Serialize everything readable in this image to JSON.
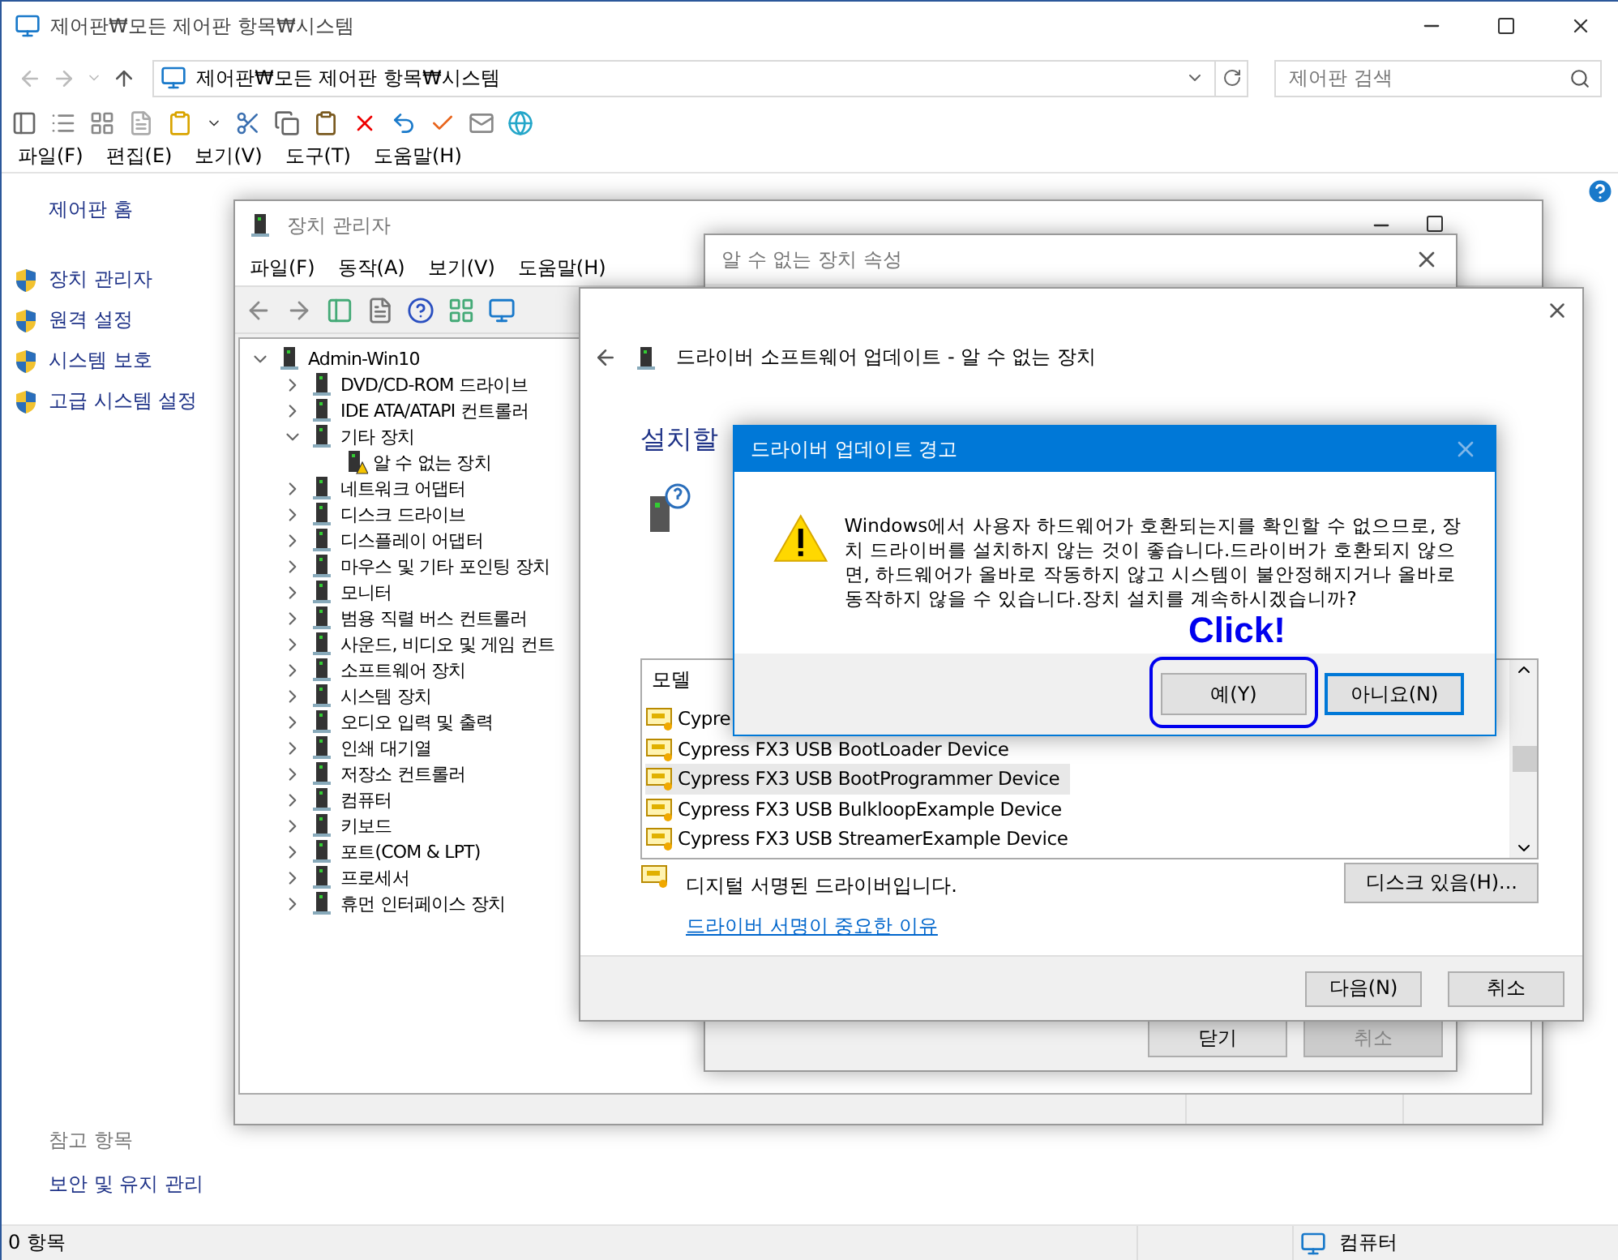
{
  "window": {
    "title": "제어판₩모든 제어판 항목₩시스템"
  },
  "address_bar": {
    "path": "제어판₩모든 제어판 항목₩시스템"
  },
  "search": {
    "placeholder": "제어판 검색"
  },
  "menu": [
    "파일(F)",
    "편집(E)",
    "보기(V)",
    "도구(T)",
    "도움말(H)"
  ],
  "sidebar": {
    "home": "제어판 홈",
    "tasks": [
      "장치 관리자",
      "원격 설정",
      "시스템 보호",
      "고급 시스템 설정"
    ],
    "see_also_title": "참고 항목",
    "see_also": [
      "보안 및 유지 관리"
    ]
  },
  "status_bar": {
    "items": "0 항목",
    "location": "컴퓨터"
  },
  "device_manager": {
    "title": "장치 관리자",
    "menu": [
      "파일(F)",
      "동작(A)",
      "보기(V)",
      "도움말(H)"
    ],
    "tree": {
      "label": "Admin-Win10",
      "expanded": true,
      "children": [
        {
          "label": "DVD/CD-ROM 드라이브",
          "expanded": false
        },
        {
          "label": "IDE ATA/ATAPI 컨트롤러",
          "expanded": false
        },
        {
          "label": "기타 장치",
          "expanded": true,
          "children": [
            {
              "label": "알 수 없는 장치",
              "warning": true
            }
          ]
        },
        {
          "label": "네트워크 어댑터",
          "expanded": false
        },
        {
          "label": "디스크 드라이브",
          "expanded": false
        },
        {
          "label": "디스플레이 어댑터",
          "expanded": false
        },
        {
          "label": "마우스 및 기타 포인팅 장치",
          "expanded": false
        },
        {
          "label": "모니터",
          "expanded": false
        },
        {
          "label": "범용 직렬 버스 컨트롤러",
          "expanded": false
        },
        {
          "label": "사운드, 비디오 및 게임 컨트",
          "expanded": false
        },
        {
          "label": "소프트웨어 장치",
          "expanded": false
        },
        {
          "label": "시스템 장치",
          "expanded": false
        },
        {
          "label": "오디오 입력 및 출력",
          "expanded": false
        },
        {
          "label": "인쇄 대기열",
          "expanded": false
        },
        {
          "label": "저장소 컨트롤러",
          "expanded": false
        },
        {
          "label": "컴퓨터",
          "expanded": false
        },
        {
          "label": "키보드",
          "expanded": false
        },
        {
          "label": "포트(COM & LPT)",
          "expanded": false
        },
        {
          "label": "프로세서",
          "expanded": false
        },
        {
          "label": "휴먼 인터페이스 장치",
          "expanded": false
        }
      ]
    }
  },
  "properties_dialog": {
    "title": "알 수 없는 장치 속성",
    "buttons": [
      {
        "label": "닫기",
        "disabled": false
      },
      {
        "label": "취소",
        "disabled": true
      }
    ]
  },
  "wizard": {
    "title": "드라이버 소프트웨어 업데이트 - 알 수 없는 장치",
    "heading": "설치할",
    "list_header": "모델",
    "models": [
      {
        "name": "Cypre",
        "selected": false
      },
      {
        "name": "Cypress FX3 USB BootLoader Device",
        "selected": false
      },
      {
        "name": "Cypress FX3 USB BootProgrammer Device",
        "selected": true
      },
      {
        "name": "Cypress FX3 USB BulkloopExample Device",
        "selected": false
      },
      {
        "name": "Cypress FX3 USB StreamerExample Device",
        "selected": false
      }
    ],
    "signed_note": "디지털 서명된 드라이버입니다.",
    "link": "드라이버 서명이 중요한 이유",
    "disk_button": "디스크 있음(H)...",
    "buttons": [
      "다음(N)",
      "취소"
    ]
  },
  "alert": {
    "title": "드라이버 업데이트 경고",
    "message": "Windows에서 사용자 하드웨어가 호환되는지를 확인할 수 없으므로, 장치 드라이버를 설치하지 않는 것이 좋습니다.드라이버가 호환되지 않으면, 하드웨어가 올바로 작동하지 않고 시스템이 불안정해지거나 올바로 동작하지 않을 수 있습니다.장치 설치를 계속하시겠습니까?",
    "annotation": "Click!",
    "buttons": [
      {
        "label": "예(Y)",
        "highlighted": true,
        "focused": false
      },
      {
        "label": "아니요(N)",
        "highlighted": false,
        "focused": true
      }
    ]
  }
}
